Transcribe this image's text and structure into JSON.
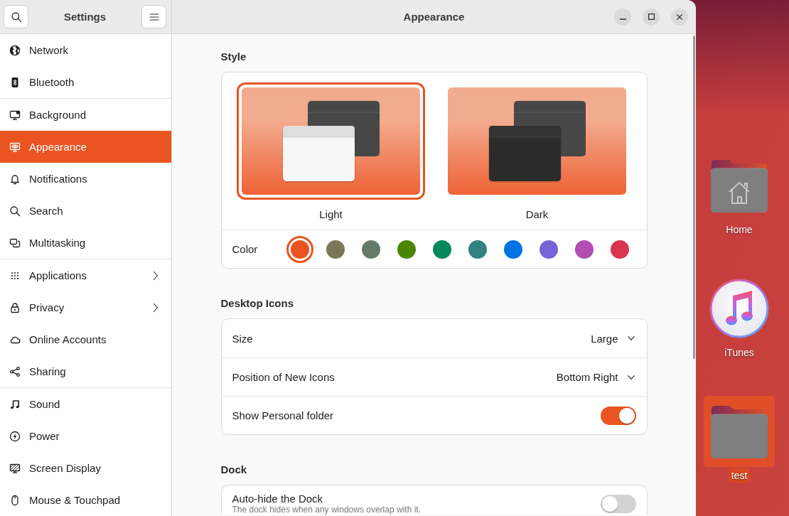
{
  "window": {
    "title": "Appearance"
  },
  "sidebar": {
    "title": "Settings",
    "groups": [
      {
        "items": [
          {
            "label": "Network",
            "selected": false,
            "submenu": false
          },
          {
            "label": "Bluetooth",
            "selected": false,
            "submenu": false
          }
        ]
      },
      {
        "items": [
          {
            "label": "Background",
            "selected": false,
            "submenu": false
          },
          {
            "label": "Appearance",
            "selected": true,
            "submenu": false
          },
          {
            "label": "Notifications",
            "selected": false,
            "submenu": false
          },
          {
            "label": "Search",
            "selected": false,
            "submenu": false
          },
          {
            "label": "Multitasking",
            "selected": false,
            "submenu": false
          }
        ]
      },
      {
        "items": [
          {
            "label": "Applications",
            "selected": false,
            "submenu": true
          },
          {
            "label": "Privacy",
            "selected": false,
            "submenu": true
          },
          {
            "label": "Online Accounts",
            "selected": false,
            "submenu": false
          },
          {
            "label": "Sharing",
            "selected": false,
            "submenu": false
          }
        ]
      },
      {
        "items": [
          {
            "label": "Sound",
            "selected": false,
            "submenu": false
          },
          {
            "label": "Power",
            "selected": false,
            "submenu": false
          },
          {
            "label": "Screen Display",
            "selected": false,
            "submenu": false
          },
          {
            "label": "Mouse & Touchpad",
            "selected": false,
            "submenu": false
          }
        ]
      }
    ]
  },
  "content": {
    "style": {
      "title": "Style",
      "themes": [
        {
          "kind": "light",
          "label": "Light",
          "selected": true
        },
        {
          "kind": "dark",
          "label": "Dark",
          "selected": false
        }
      ],
      "color_label": "Color",
      "accent_colors": [
        {
          "color": "#e95420",
          "selected": true
        },
        {
          "color": "#787859",
          "selected": false
        },
        {
          "color": "#657b69",
          "selected": false
        },
        {
          "color": "#4b8501",
          "selected": false
        },
        {
          "color": "#03875b",
          "selected": false
        },
        {
          "color": "#308280",
          "selected": false
        },
        {
          "color": "#0073e5",
          "selected": false
        },
        {
          "color": "#7764d8",
          "selected": false
        },
        {
          "color": "#b34cb3",
          "selected": false
        },
        {
          "color": "#da3450",
          "selected": false
        }
      ]
    },
    "groups": [
      {
        "title": "Desktop Icons",
        "rows": [
          {
            "kind": "dropdown",
            "label": "Size",
            "value": "Large"
          },
          {
            "kind": "dropdown",
            "label": "Position of New Icons",
            "value": "Bottom Right"
          },
          {
            "kind": "switch",
            "label": "Show Personal folder",
            "on": true
          }
        ]
      },
      {
        "title": "Dock",
        "rows": [
          {
            "kind": "switch",
            "label": "Auto-hide the Dock",
            "description": "The dock hides when any windows overlap with it.",
            "on": false
          }
        ]
      }
    ]
  },
  "desktop": {
    "icons": [
      {
        "kind": "home",
        "label": "Home",
        "selected": false
      },
      {
        "kind": "app",
        "label": "iTunes",
        "selected": false
      },
      {
        "kind": "folder",
        "label": "test",
        "selected": true
      }
    ]
  }
}
